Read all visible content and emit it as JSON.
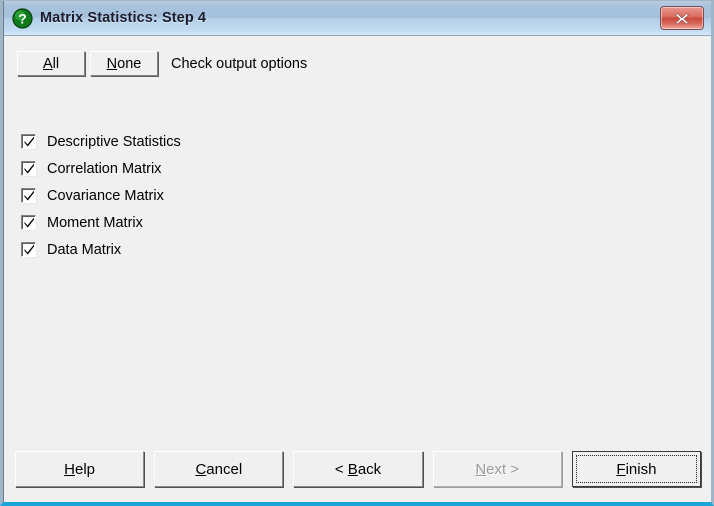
{
  "window": {
    "title": "Matrix Statistics: Step 4",
    "title_icon": "question-mark-green-icon",
    "close_icon": "close-icon",
    "close_label": "X",
    "accent_titlebar": "#a8c2dd",
    "accent_border": "#1ba6d8",
    "body_background": "#f0f0f0"
  },
  "toolbar": {
    "all_button": {
      "prefix": "",
      "accel": "A",
      "suffix": "ll"
    },
    "none_button": {
      "prefix": "",
      "accel": "N",
      "suffix": "one"
    },
    "instruction": "Check output options"
  },
  "options": [
    {
      "label": "Descriptive Statistics",
      "checked": true
    },
    {
      "label": "Correlation Matrix",
      "checked": true
    },
    {
      "label": "Covariance Matrix",
      "checked": true
    },
    {
      "label": "Moment Matrix",
      "checked": true
    },
    {
      "label": "Data Matrix",
      "checked": true
    }
  ],
  "buttons": [
    {
      "name": "help",
      "prefix": "",
      "accel": "H",
      "suffix": "elp",
      "disabled": false,
      "default": false
    },
    {
      "name": "cancel",
      "prefix": "",
      "accel": "C",
      "suffix": "ancel",
      "disabled": false,
      "default": false
    },
    {
      "name": "back",
      "prefix": "< ",
      "accel": "B",
      "suffix": "ack",
      "disabled": false,
      "default": false
    },
    {
      "name": "next",
      "prefix": "",
      "accel": "N",
      "suffix": "ext >",
      "disabled": true,
      "default": false
    },
    {
      "name": "finish",
      "prefix": "",
      "accel": "F",
      "suffix": "inish",
      "disabled": false,
      "default": true
    }
  ]
}
